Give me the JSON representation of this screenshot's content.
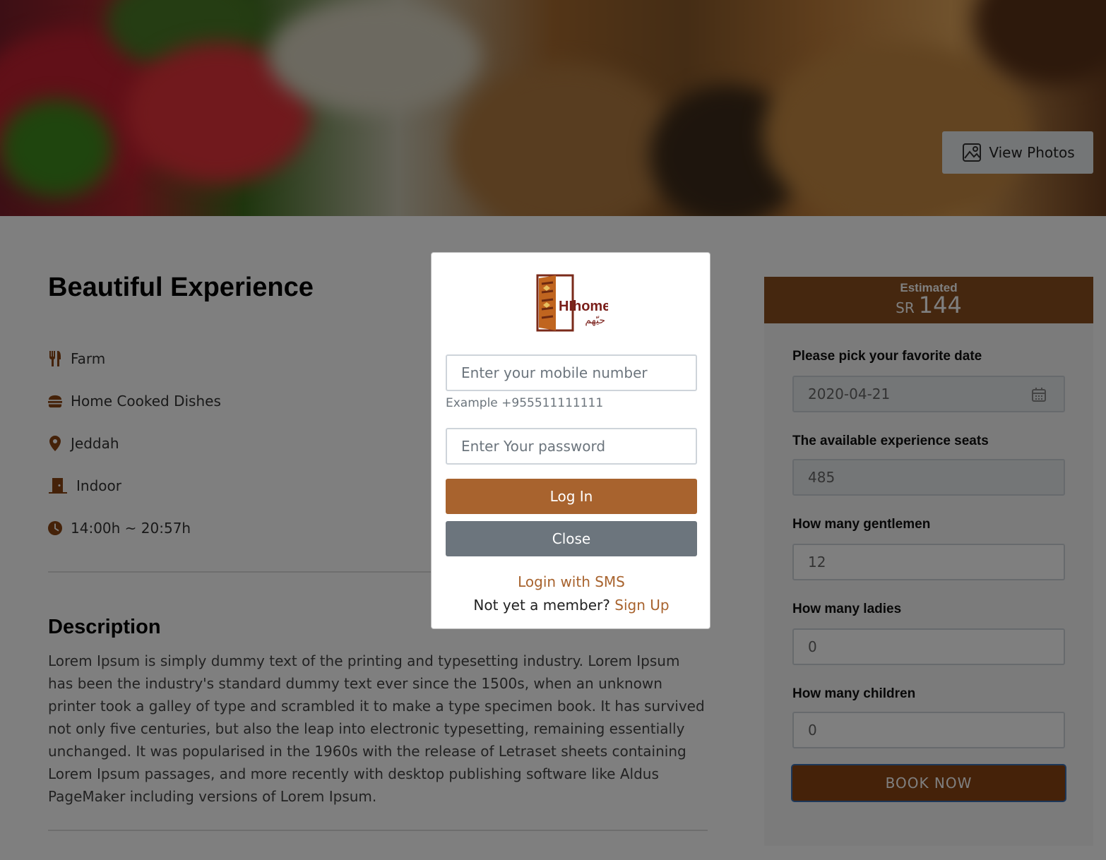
{
  "hero": {
    "view_photos_label": "View Photos"
  },
  "experience": {
    "title": "Beautiful Experience",
    "features": [
      {
        "icon": "utensils-icon",
        "label": "Farm"
      },
      {
        "icon": "burger-icon",
        "label": "Home Cooked Dishes"
      },
      {
        "icon": "map-pin-icon",
        "label": "Jeddah"
      },
      {
        "icon": "door-icon",
        "label": "Indoor"
      },
      {
        "icon": "clock-icon",
        "label": "14:00h ~ 20:57h"
      }
    ],
    "description_title": "Description",
    "description": "Lorem Ipsum is simply dummy text of the printing and typesetting industry. Lorem Ipsum has been the industry's standard dummy text ever since the 1500s, when an unknown printer took a galley of type and scrambled it to make a type specimen book. It has survived not only five centuries, but also the leap into electronic typesetting, remaining essentially unchanged. It was popularised in the 1960s with the release of Letraset sheets containing Lorem Ipsum passages, and more recently with desktop publishing software like Aldus PageMaker including versions of Lorem Ipsum."
  },
  "booking": {
    "estimated_label": "Estimated",
    "currency": "SR",
    "price": "144",
    "date_label": "Please pick your favorite date",
    "date_value": "2020-04-21",
    "seats_label": "The available experience seats",
    "seats_value": "485",
    "gentlemen_label": "How many gentlemen",
    "gentlemen_value": "12",
    "ladies_label": "How many ladies",
    "ladies_value": "0",
    "children_label": "How many children",
    "children_value": "0",
    "book_label": "BOOK NOW",
    "brand_color": "#8b4513"
  },
  "modal": {
    "logo_text": "HIhome",
    "logo_arabic": "حيّهم",
    "mobile_placeholder": "Enter your mobile number",
    "mobile_help": "Example +955511111111",
    "password_placeholder": "Enter Your password",
    "login_label": "Log In",
    "close_label": "Close",
    "sms_label": "Login with SMS",
    "member_prompt": "Not yet a member?",
    "signup_label": "Sign Up",
    "accent_color": "#a8632e"
  }
}
